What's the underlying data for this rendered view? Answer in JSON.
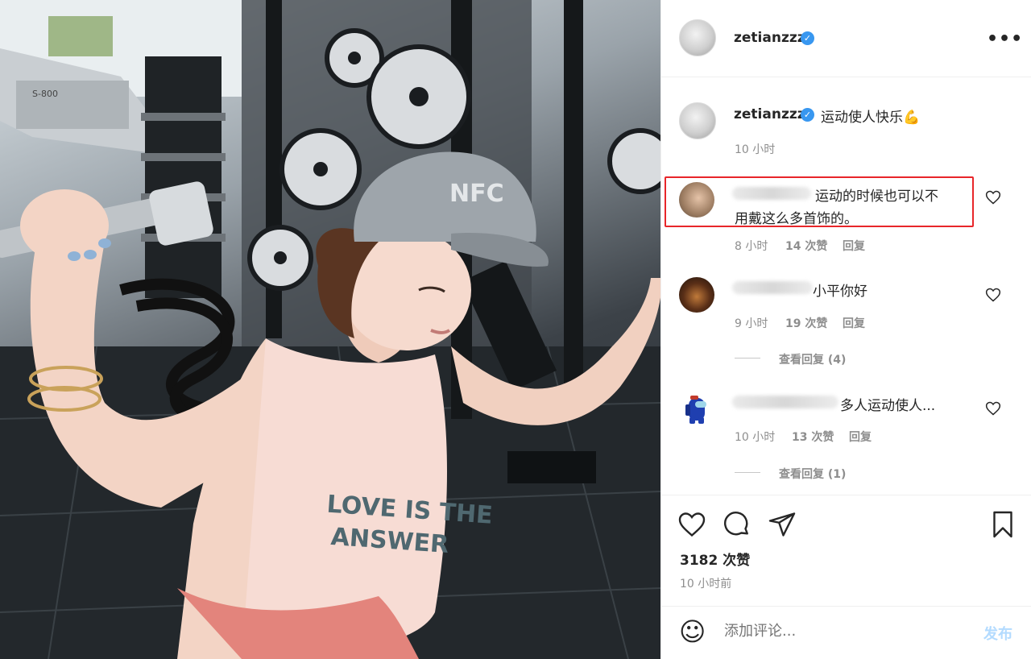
{
  "post": {
    "owner": "zetianzzz",
    "caption": "运动使人快乐💪",
    "caption_time": "10 小时",
    "likes": "3182 次赞",
    "time_ago": "10 小时前",
    "more_label": "•••",
    "verified_mark": "✓"
  },
  "photo": {
    "cap_text": "NFC",
    "shirt_line1": "LOVE IS THE",
    "shirt_line2": "ANSWER",
    "treadmill_label": "S-800"
  },
  "comments": [
    {
      "text_line1": "运动的时候也可以不",
      "text_line2": "用戴这么多首饰的。",
      "time": "8 小时",
      "likes": "14 次赞",
      "reply": "回复"
    },
    {
      "text_line1": "小平你好",
      "time": "9 小时",
      "likes": "19 次赞",
      "reply": "回复",
      "view_replies": "查看回复 (4)"
    },
    {
      "text_line1": "多人运动使人...",
      "time": "10 小时",
      "likes": "13 次赞",
      "reply": "回复",
      "view_replies": "查看回复 (1)"
    }
  ],
  "comment_box": {
    "placeholder": "添加评论...",
    "post_label": "发布",
    "emoji": "☺"
  },
  "colors": {
    "highlight": "#e8262a",
    "verified": "#3897f0",
    "post_disabled": "#b3dbff"
  }
}
